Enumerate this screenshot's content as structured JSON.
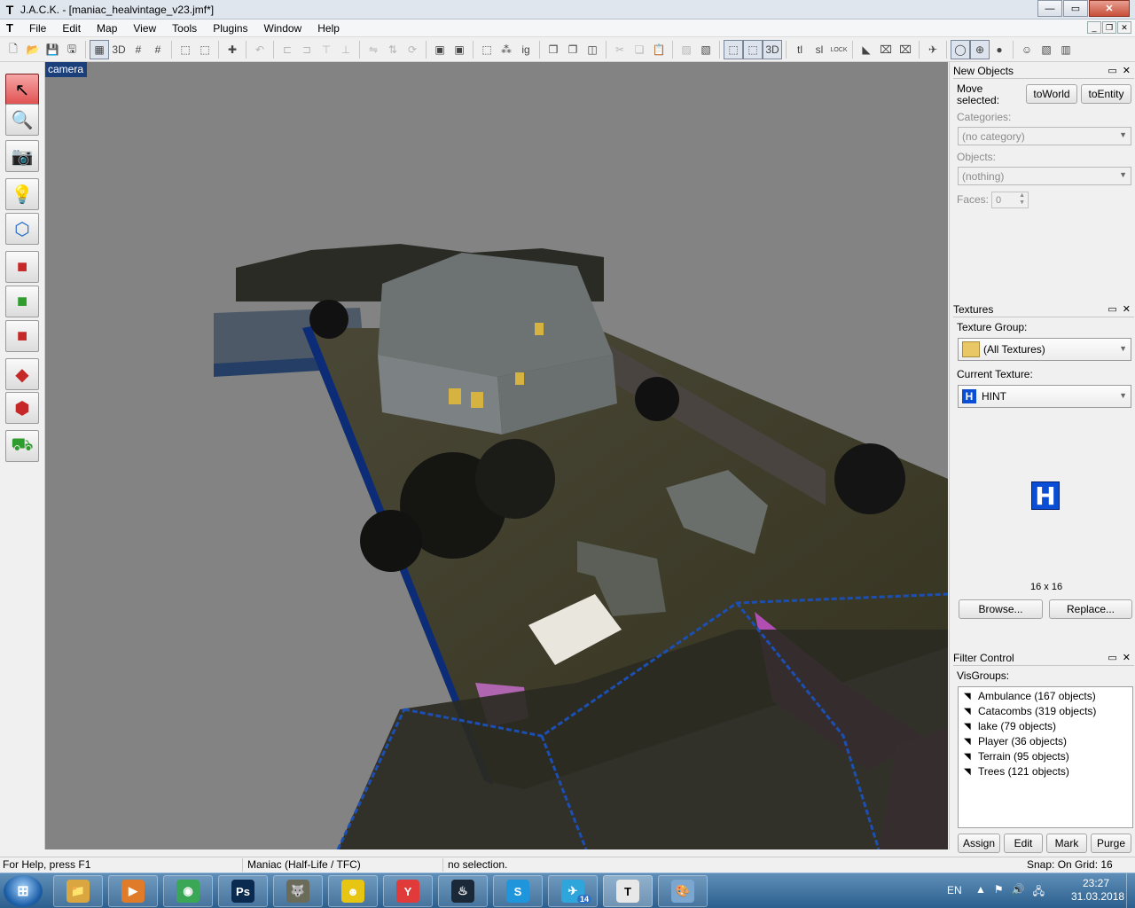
{
  "window": {
    "title": "J.A.C.K. - [maniac_healvintage_v23.jmf*]",
    "app_icon": "T",
    "controls": {
      "minimize": "—",
      "maximize": "▭",
      "close": "✕"
    }
  },
  "menu": {
    "doc_icon": "T",
    "items": [
      "File",
      "Edit",
      "Map",
      "View",
      "Tools",
      "Plugins",
      "Window",
      "Help"
    ],
    "mdi": {
      "minimize": "_",
      "restore": "❐",
      "close": "✕"
    }
  },
  "toolbar": {
    "items": [
      {
        "name": "new-icon",
        "glyph": "🗋"
      },
      {
        "name": "open-icon",
        "glyph": "📂"
      },
      {
        "name": "save-icon",
        "glyph": "💾"
      },
      {
        "name": "save-as-icon",
        "glyph": "🖫"
      },
      {
        "sep": true
      },
      {
        "name": "grid-icon",
        "glyph": "▦",
        "pressed": true
      },
      {
        "name": "grid-3d-icon",
        "glyph": "3D"
      },
      {
        "name": "grid-small-icon",
        "glyph": "#"
      },
      {
        "name": "grid-large-icon",
        "glyph": "#"
      },
      {
        "sep": true
      },
      {
        "name": "vertex-icon",
        "glyph": "⬚"
      },
      {
        "name": "vertex2-icon",
        "glyph": "⬚"
      },
      {
        "sep": true
      },
      {
        "name": "snap-icon",
        "glyph": "✚"
      },
      {
        "sep": true
      },
      {
        "name": "undo-icon",
        "glyph": "↶",
        "dim": true
      },
      {
        "sep": true
      },
      {
        "name": "align-left-icon",
        "glyph": "⊏",
        "dim": true
      },
      {
        "name": "align-right-icon",
        "glyph": "⊐",
        "dim": true
      },
      {
        "name": "align-top-icon",
        "glyph": "⊤",
        "dim": true
      },
      {
        "name": "align-bottom-icon",
        "glyph": "⊥",
        "dim": true
      },
      {
        "sep": true
      },
      {
        "name": "flip-h-icon",
        "glyph": "⇋",
        "dim": true
      },
      {
        "name": "flip-v-icon",
        "glyph": "⇅",
        "dim": true
      },
      {
        "name": "rotate-icon",
        "glyph": "⟳",
        "dim": true
      },
      {
        "sep": true
      },
      {
        "name": "entity-to-world-icon",
        "glyph": "▣"
      },
      {
        "name": "world-to-entity-icon",
        "glyph": "▣"
      },
      {
        "sep": true
      },
      {
        "name": "carve-icon",
        "glyph": "⬚"
      },
      {
        "name": "hollow-icon",
        "glyph": "⁂"
      },
      {
        "name": "ig-icon",
        "glyph": "ig"
      },
      {
        "sep": true
      },
      {
        "name": "group-icon",
        "glyph": "❒"
      },
      {
        "name": "ungroup-icon",
        "glyph": "❐"
      },
      {
        "name": "hide-icon",
        "glyph": "◫"
      },
      {
        "sep": true
      },
      {
        "name": "cut-icon",
        "glyph": "✂",
        "dim": true
      },
      {
        "name": "copy-icon",
        "glyph": "❏",
        "dim": true
      },
      {
        "name": "paste-icon",
        "glyph": "📋",
        "dim": true
      },
      {
        "sep": true
      },
      {
        "name": "texture-lock-icon",
        "glyph": "▨",
        "dim": true
      },
      {
        "name": "texture-lock2-icon",
        "glyph": "▧"
      },
      {
        "sep": true
      },
      {
        "name": "view-2d-icon",
        "glyph": "⬚",
        "pressed": true
      },
      {
        "name": "view-2d-b-icon",
        "glyph": "⬚",
        "pressed": true
      },
      {
        "name": "view-3d-icon",
        "glyph": "3D",
        "pressed": true
      },
      {
        "sep": true
      },
      {
        "name": "tl-icon",
        "glyph": "tl"
      },
      {
        "name": "sl-icon",
        "glyph": "sl"
      },
      {
        "name": "lock-icon",
        "glyph": "LOCK"
      },
      {
        "sep": true
      },
      {
        "name": "carve-tool-icon",
        "glyph": "◣"
      },
      {
        "name": "clip-red-icon",
        "glyph": "⌧"
      },
      {
        "name": "clip-green-icon",
        "glyph": "⌧"
      },
      {
        "sep": true
      },
      {
        "name": "run-map-icon",
        "glyph": "✈"
      },
      {
        "sep": true
      },
      {
        "name": "sphere-icon",
        "glyph": "◯",
        "pressed": true
      },
      {
        "name": "arrow-up-icon",
        "glyph": "⊕",
        "pressed": true
      },
      {
        "name": "dots-icon",
        "glyph": "●"
      },
      {
        "sep": true
      },
      {
        "name": "face-icon",
        "glyph": "☺"
      },
      {
        "name": "image-icon",
        "glyph": "▧"
      },
      {
        "name": "book-icon",
        "glyph": "▥"
      }
    ]
  },
  "palette": {
    "items": [
      {
        "name": "select-tool-icon",
        "glyph": "↖",
        "cls": "active"
      },
      {
        "name": "magnify-tool-icon",
        "glyph": "🔍",
        "cls": "red"
      },
      {
        "name": "camera-tool-icon",
        "glyph": "📷",
        "cls": "red"
      },
      {
        "name": "light-tool-icon",
        "glyph": "💡",
        "cls": "blue"
      },
      {
        "name": "cube-wire-tool-icon",
        "glyph": "⬡",
        "cls": "blue"
      },
      {
        "name": "block-tool-icon",
        "glyph": "■",
        "cls": "red"
      },
      {
        "name": "block-green-tool-icon",
        "glyph": "■",
        "cls": "green"
      },
      {
        "name": "block-red-tool-icon",
        "glyph": "■",
        "cls": "red"
      },
      {
        "name": "texture-app-tool-icon",
        "glyph": "◆",
        "cls": "red"
      },
      {
        "name": "vertex-tool-icon",
        "glyph": "⬢",
        "cls": "red"
      },
      {
        "name": "path-tool-icon",
        "glyph": "⛟",
        "cls": "green"
      }
    ]
  },
  "viewport": {
    "label": "camera",
    "background": "#838383"
  },
  "new_objects": {
    "title": "New Objects",
    "float_icon": "▭",
    "close_icon": "✕",
    "move_selected_label": "Move\nselected:",
    "to_world": "toWorld",
    "to_entity": "toEntity",
    "categories_label": "Categories:",
    "categories_value": "(no category)",
    "objects_label": "Objects:",
    "objects_value": "(nothing)",
    "faces_label": "Faces:",
    "faces_value": "0"
  },
  "textures": {
    "title": "Textures",
    "group_label": "Texture Group:",
    "group_value": "(All Textures)",
    "current_label": "Current Texture:",
    "current_value": "HINT",
    "preview_glyph": "H",
    "size": "16 x 16",
    "browse": "Browse...",
    "replace": "Replace..."
  },
  "filter": {
    "title": "Filter Control",
    "visgroups_label": "VisGroups:",
    "groups": [
      "Ambulance (167 objects)",
      "Catacombs (319 objects)",
      "lake (79 objects)",
      "Player (36 objects)",
      "Terrain (95 objects)",
      "Trees (121 objects)"
    ],
    "assign": "Assign",
    "edit": "Edit",
    "mark": "Mark",
    "purge": "Purge"
  },
  "status": {
    "help": "For Help, press F1",
    "game": "Maniac (Half-Life / TFC)",
    "selection": "no selection.",
    "snap": "Snap: On Grid: 16"
  },
  "taskbar": {
    "start_glyph": "⊞",
    "apps": [
      {
        "name": "explorer-icon",
        "glyph": "📁",
        "bg": "#d9a640"
      },
      {
        "name": "media-player-icon",
        "glyph": "▶",
        "bg": "#e07b2a"
      },
      {
        "name": "chrome-icon",
        "glyph": "◉",
        "bg": "#3aa757"
      },
      {
        "name": "photoshop-icon",
        "glyph": "Ps",
        "bg": "#0a2a4f"
      },
      {
        "name": "gimp-icon",
        "glyph": "🐺",
        "bg": "#6b6b5a"
      },
      {
        "name": "happy-icon",
        "glyph": "☻",
        "bg": "#e6c612"
      },
      {
        "name": "yandex-icon",
        "glyph": "Y",
        "bg": "#e03a3a"
      },
      {
        "name": "steam-icon",
        "glyph": "♨",
        "bg": "#1b2838"
      },
      {
        "name": "skype-icon",
        "glyph": "S",
        "bg": "#1f95db"
      },
      {
        "name": "telegram-icon",
        "glyph": "✈",
        "bg": "#2ea6db",
        "badge": "14"
      },
      {
        "name": "jack-icon",
        "glyph": "T",
        "bg": "#e8e8e8",
        "active": true
      },
      {
        "name": "paint-icon",
        "glyph": "🎨",
        "bg": "#7aa6cf"
      }
    ],
    "lang": "EN",
    "tray_icons": [
      "▲",
      "⚑",
      "🔊",
      "🖧"
    ],
    "time": "23:27",
    "date": "31.03.2018"
  }
}
